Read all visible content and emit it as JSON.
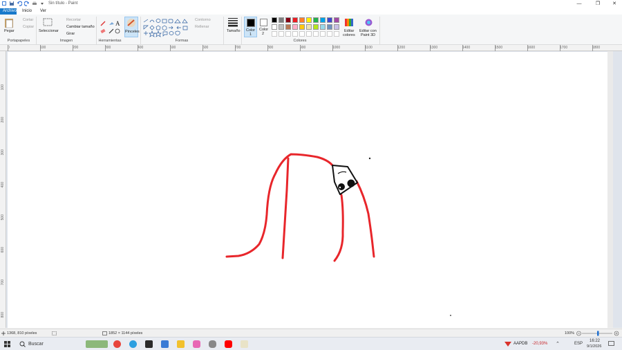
{
  "window": {
    "title": "Sin título - Paint",
    "minimize": "—",
    "maximize": "❐",
    "close": "✕"
  },
  "menu": {
    "tabs": [
      {
        "label": "Archivo"
      },
      {
        "label": "Inicio"
      },
      {
        "label": "Ver"
      }
    ]
  },
  "ribbon": {
    "clipboard": {
      "paste": "Pegar",
      "cut": "Cortar",
      "copy": "Copiar",
      "group": "Portapapeles"
    },
    "image": {
      "select": "Seleccionar",
      "crop": "Recortar",
      "resize": "Cambiar tamaño",
      "rotate": "Girar",
      "group": "Imagen"
    },
    "tools": {
      "group": "Herramientas",
      "brushes": "Pinceles"
    },
    "shapes": {
      "group": "Formas",
      "outline": "Contorno",
      "fill": "Rellenar"
    },
    "size": "Tamaño",
    "colors": {
      "color1": "Color",
      "color1_num": "1",
      "color2": "Color",
      "color2_num": "2",
      "edit": "Editar",
      "edit2": "colores",
      "paint3d": "Editar con",
      "paint3d2": "Paint 3D",
      "group": "Colores",
      "palette": [
        "#000000",
        "#7f7f7f",
        "#880015",
        "#ed1c24",
        "#ff7f27",
        "#fff200",
        "#22b14c",
        "#00a2e8",
        "#3f48cc",
        "#a349a4",
        "#ffffff",
        "#c3c3c3",
        "#b97a57",
        "#ffaec9",
        "#ffc90e",
        "#efe4b0",
        "#b5e61d",
        "#99d9ea",
        "#7092be",
        "#c8bfe7"
      ]
    }
  },
  "ruler": {
    "h": [
      "0",
      "100",
      "200",
      "300",
      "400",
      "500",
      "600",
      "700",
      "800",
      "900",
      "1000",
      "1100",
      "1200",
      "1300",
      "1400",
      "1500",
      "1600",
      "1700",
      "1800"
    ],
    "v": [
      "100",
      "200",
      "300",
      "400",
      "500",
      "600",
      "700",
      "800"
    ]
  },
  "status": {
    "cursor_pos": "1368, 810 píxeles",
    "image_size": "1852 × 1144 píxeles",
    "zoom": "100%"
  },
  "taskbar": {
    "search": "Buscar",
    "stock_name": "AAPDB",
    "stock_change": "-20,93%",
    "lang": "ESP",
    "time": "16:22",
    "date": "9/1/2026"
  }
}
